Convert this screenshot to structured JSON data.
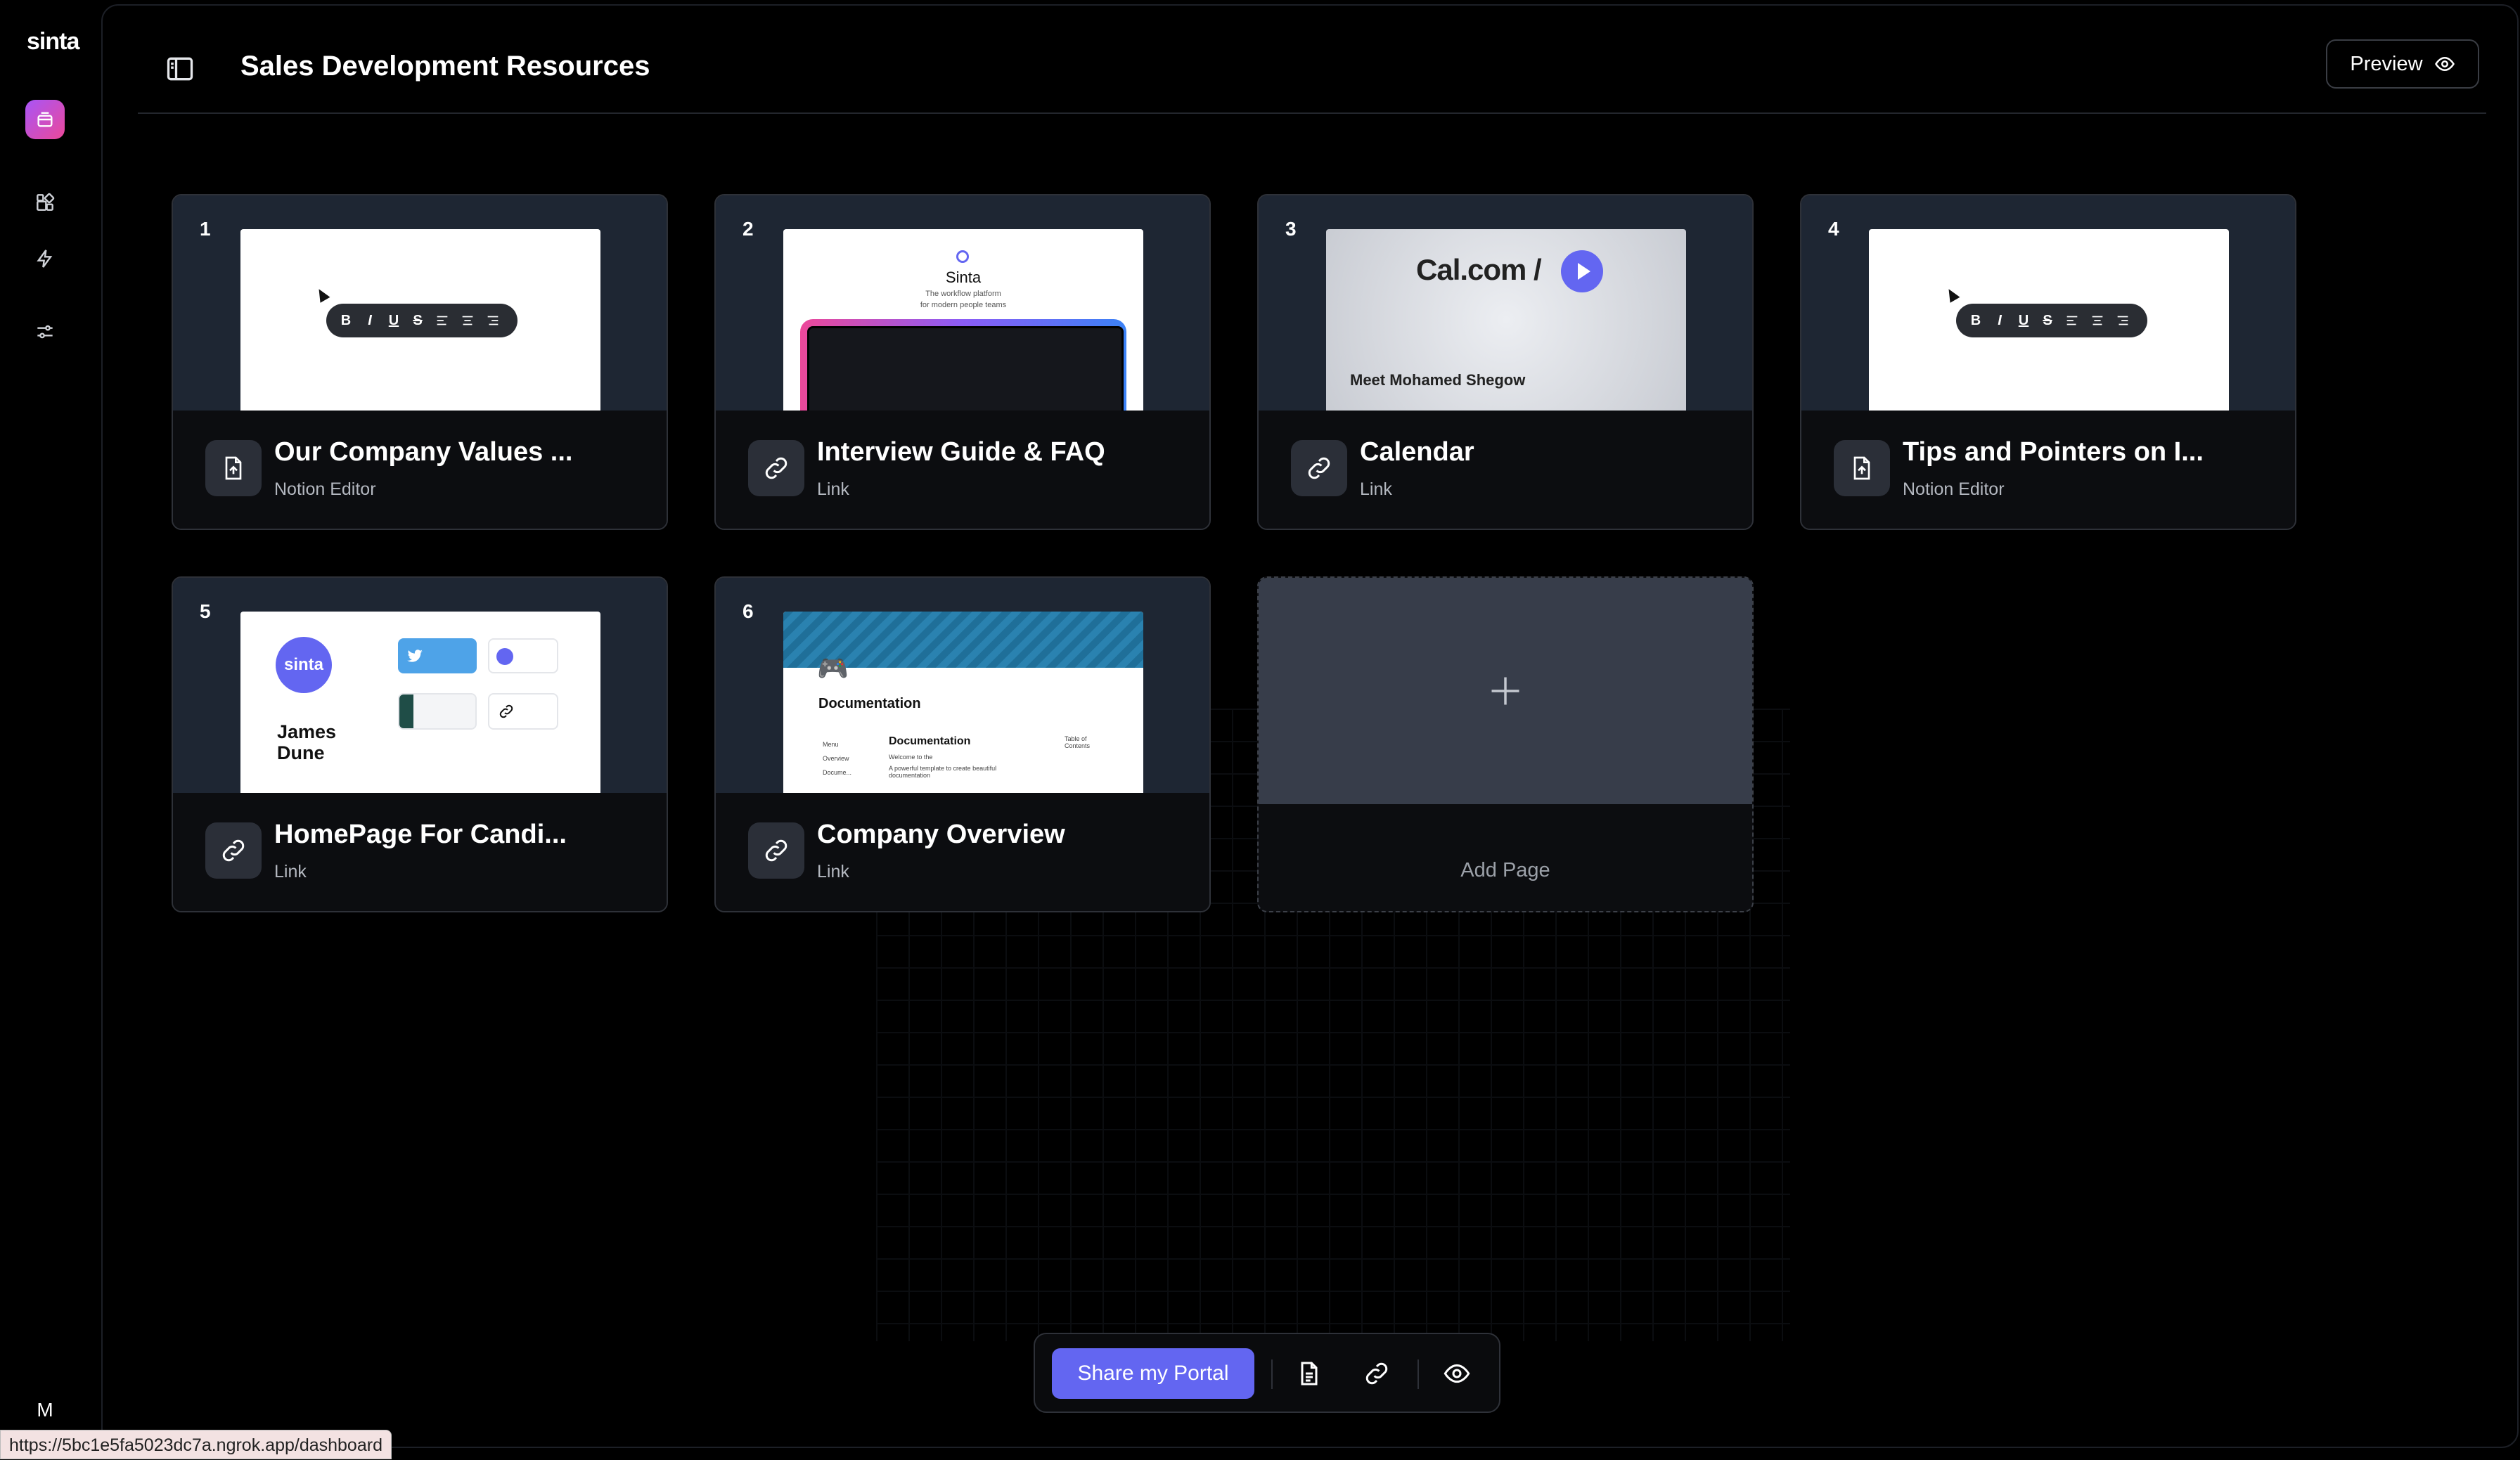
{
  "rail": {
    "logo": "sinta",
    "avatar_initial": "M"
  },
  "header": {
    "title": "Sales Development Resources",
    "preview_label": "Preview"
  },
  "cards": [
    {
      "num": "1",
      "title": "Our Company Values ...",
      "type": "Notion Editor"
    },
    {
      "num": "2",
      "title": "Interview Guide & FAQ",
      "type": "Link"
    },
    {
      "num": "3",
      "title": "Calendar",
      "type": "Link"
    },
    {
      "num": "4",
      "title": "Tips and Pointers on I...",
      "type": "Notion Editor"
    },
    {
      "num": "5",
      "title": "HomePage For Candi...",
      "type": "Link"
    },
    {
      "num": "6",
      "title": "Company Overview",
      "type": "Link"
    }
  ],
  "thumbs": {
    "fmt": {
      "b": "B",
      "i": "I",
      "u": "U",
      "s": "S"
    },
    "interview": {
      "brand": "Sinta",
      "tagline1": "The workflow platform",
      "tagline2": "for modern people teams"
    },
    "calendar": {
      "brand": "Cal.com /",
      "caption": "Meet Mohamed Shegow"
    },
    "homepage": {
      "logo": "sinta",
      "name_line1": "James",
      "name_line2": "Dune"
    },
    "overview": {
      "heading": "Documentation",
      "subheading": "Documentation",
      "menu": "Menu",
      "overview": "Overview",
      "docs": "Docume...",
      "toc": "Table of Contents",
      "body1": "Welcome to the",
      "body2": "A powerful template to create beautiful documentation"
    }
  },
  "add_page_label": "Add Page",
  "toolbar": {
    "share_label": "Share my Portal"
  },
  "status_url": "https://5bc1e5fa5023dc7a.ngrok.app/dashboard",
  "colors": {
    "accent": "#6366f1",
    "thumb_bg": "#1e2633",
    "active_gradient_start": "#a855f7",
    "active_gradient_end": "#ec4899"
  },
  "icons": {
    "rail": [
      "portal-icon",
      "widgets-icon",
      "lightning-icon",
      "sliders-icon"
    ],
    "types": {
      "Notion Editor": "document-icon",
      "Link": "link-icon"
    }
  }
}
